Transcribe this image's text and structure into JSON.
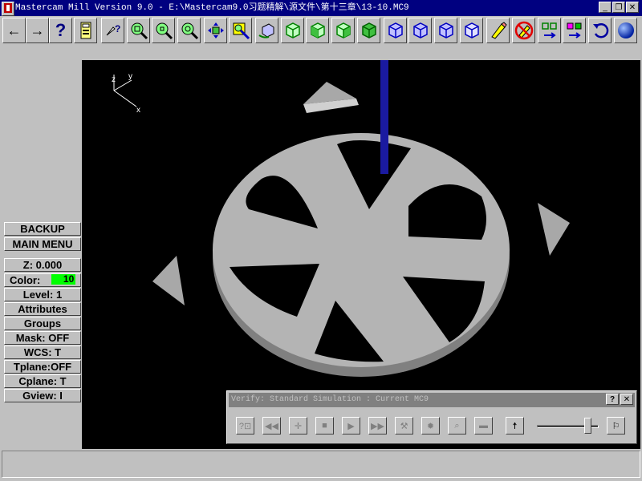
{
  "window": {
    "title": "Mastercam Mill Version 9.0 - E:\\Mastercam9.0习题精解\\源文件\\第十三章\\13-10.MC9",
    "minimize_label": "_",
    "maximize_label": "❐",
    "close_label": "✕"
  },
  "toolbar": {
    "back_label": "←",
    "forward_label": "→",
    "help_label": "?"
  },
  "menu": {
    "backup": "BACKUP",
    "main_menu": "MAIN MENU",
    "z": "Z:  0.000",
    "color_label": "Color:",
    "color_value": "10",
    "level": "Level:  1",
    "attributes": "Attributes",
    "groups": "Groups",
    "mask": "Mask:  OFF",
    "wcs": "WCS:  T",
    "tplane": "Tplane:OFF",
    "cplane": "Cplane:  T",
    "gview": "Gview:  I"
  },
  "viewport": {
    "axis_x": "x",
    "axis_y": "y",
    "axis_z": "z"
  },
  "verify_dialog": {
    "title": "Verify: Standard Simulation : Current MC9",
    "help_label": "?",
    "close_label": "✕",
    "speed_fraction": 0.9
  },
  "colors": {
    "titlebar": "#000080",
    "face": "#c0c0c0",
    "viewport_bg": "#000000",
    "part": "#b4b4b4",
    "tool": "#1a1aa0",
    "color_swatch": "#00ff00"
  }
}
